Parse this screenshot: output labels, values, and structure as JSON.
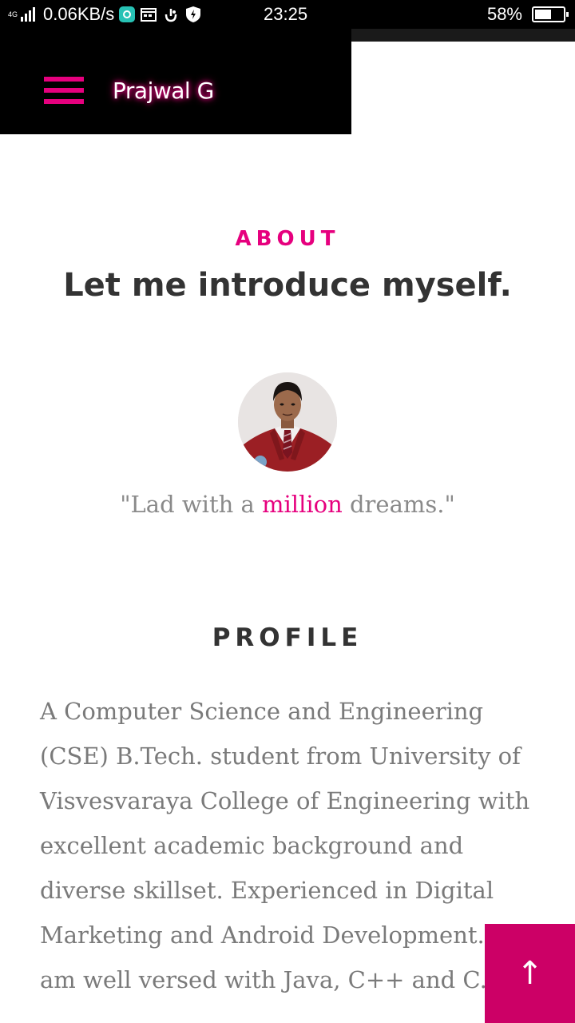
{
  "status_bar": {
    "network_type": "4G",
    "net_speed": "0.06KB/s",
    "time": "23:25",
    "battery_percent": "58%",
    "battery_level": 0.58,
    "icons": [
      "signal-icon",
      "app-notification-icon",
      "calendar-icon",
      "hand-icon",
      "shield-icon",
      "battery-icon"
    ]
  },
  "header": {
    "site_name": "Prajwal G",
    "menu_icon": "hamburger-menu-icon"
  },
  "about": {
    "label": "ABOUT",
    "heading": "Let me introduce myself.",
    "tagline_pre": "\"Lad with a ",
    "tagline_highlight": "million",
    "tagline_post": " dreams.\""
  },
  "profile": {
    "heading": "PROFILE",
    "lines": [
      "A Computer Science and Engineering",
      "(CSE) B.Tech. student from University of",
      "Visvesvaraya College of Engineering with",
      "excellent academic background and",
      "diverse skillset. Experienced in Digital",
      "Marketing and Android Development. I",
      "am well versed with Java, C++ and C."
    ]
  },
  "back_to_top": {
    "icon": "arrow-up-icon",
    "glyph": "↑"
  },
  "colors": {
    "accent": "#e6007e",
    "back_to_top_bg": "#cc0066",
    "header_bg": "#000000",
    "heading_text": "#333333",
    "body_text": "#7a7a7a"
  }
}
